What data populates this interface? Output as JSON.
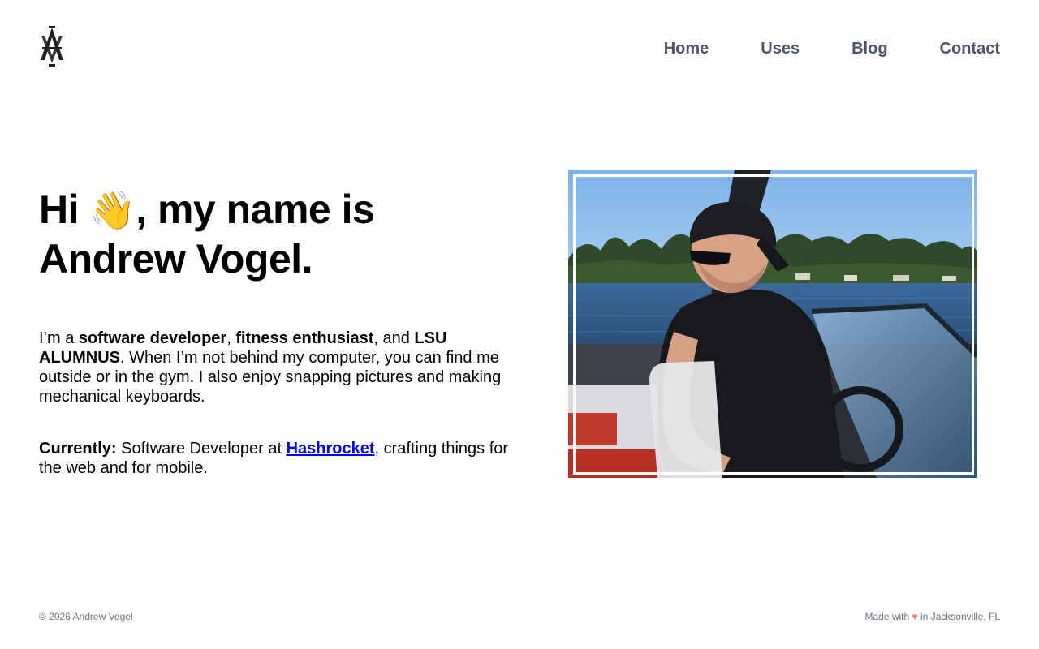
{
  "header": {
    "logo_icon": "av-monogram-icon",
    "nav": [
      {
        "label": "Home"
      },
      {
        "label": "Uses"
      },
      {
        "label": "Blog"
      },
      {
        "label": "Contact"
      }
    ]
  },
  "hero": {
    "heading_pre": "Hi ",
    "wave_emoji": "👋",
    "heading_post": ", my name is",
    "heading_line2": "Andrew Vogel.",
    "bio": {
      "t1": "I’m a ",
      "b1": "software developer",
      "t2": ", ",
      "b2": "fitness enthusiast",
      "t3": ", and ",
      "b3": "LSU ALUMNUS",
      "t4": ". When I’m not behind my computer, you can find me outside or in the gym. I also enjoy snapping pictures and making mechanical keyboards."
    },
    "current": {
      "label": "Currently:",
      "text1": " Software Developer at ",
      "link": "Hashrocket",
      "text2": ", crafting things for the web and for mobile."
    },
    "photo_icon": "profile-photo"
  },
  "footer": {
    "copyright": "© 2026 Andrew Vogel",
    "made_with_pre": "Made with ",
    "heart": "♥",
    "made_with_post": " in Jacksonville, FL"
  },
  "colors": {
    "nav_text": "#4a5568",
    "link": "#0000ee",
    "heart": "#f87171",
    "footer_text": "#6b7280"
  }
}
